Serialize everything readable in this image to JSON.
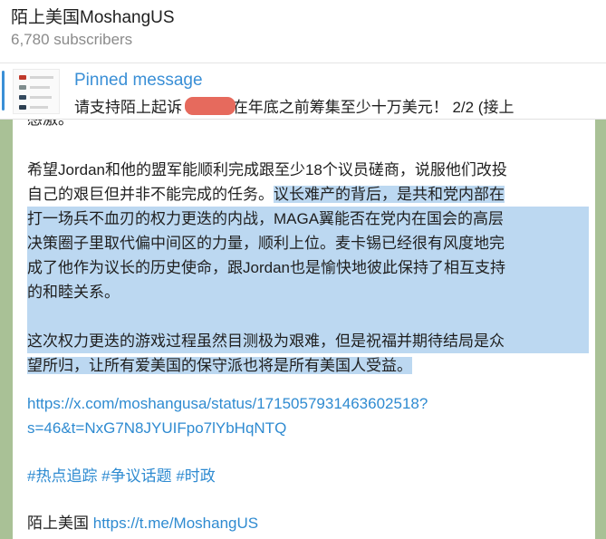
{
  "header": {
    "channel_name": "陌上美国MoshangUS",
    "subscribers": "6,780 subscribers"
  },
  "pinned": {
    "label": "Pinned message",
    "text": "请支持陌上起诉        ，需要在年底之前筹集至少十万美元！   2/2 (接上"
  },
  "message": {
    "cut_line": "感激。",
    "p1_lines": [
      "希望Jordan和他的盟军能顺利完成跟至少18个议员磋商，说服他们改投",
      "自己的艰巨但并非不能完成的任务。",
      "议长难产的背后，是共和党内部在",
      "打一场兵不血刃的权力更迭的内战，MAGA翼能否在党内在国会的高层",
      "决策圈子里取代偏中间区的力量，顺利上位。麦卡锡已经很有风度地完",
      "成了他作为议长的历史使命，跟Jordan也是愉快地彼此保持了相互支持",
      "的和睦关系。"
    ],
    "p2_lines": [
      "这次权力更迭的游戏过程虽然目测极为艰难，但是祝福并期待结局是众",
      "望所归，让所有爱美国的保守派也将是所有美国人受益。"
    ],
    "link_lines": [
      "https://x.com/moshangusa/status/1715057931463602518?",
      "s=46&t=NxG7N8JYUIFpo7lYbHqNTQ"
    ],
    "hashtags": "#热点追踪 #争议话题 #时政",
    "signature_name": "陌上美国",
    "signature_link": "https://t.me/MoshangUS"
  }
}
